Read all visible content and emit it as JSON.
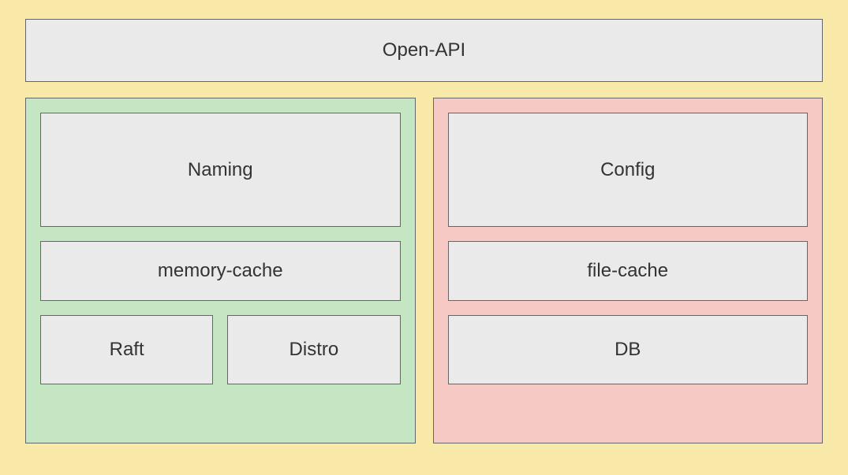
{
  "top": {
    "label": "Open-API"
  },
  "left": {
    "card1": "Naming",
    "card2": "memory-cache",
    "card3a": "Raft",
    "card3b": "Distro"
  },
  "right": {
    "card1": "Config",
    "card2": "file-cache",
    "card3": "DB"
  }
}
